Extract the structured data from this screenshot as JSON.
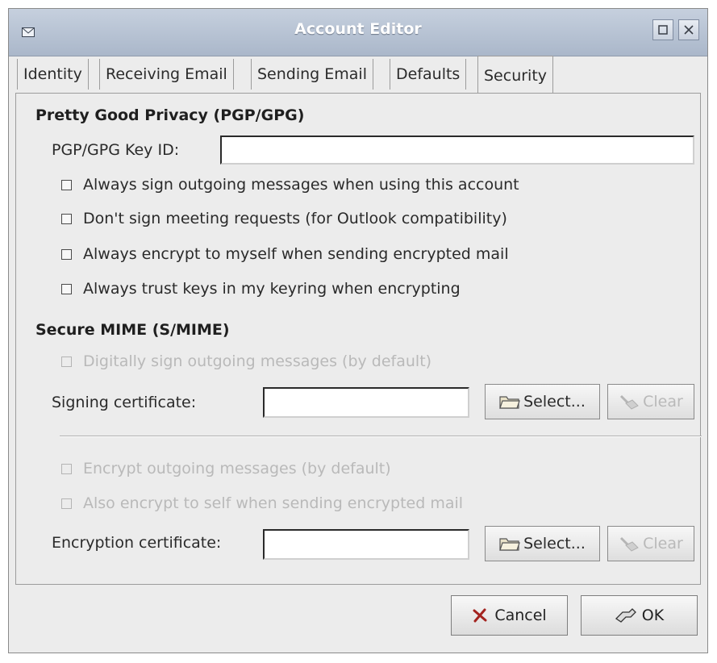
{
  "window": {
    "title": "Account Editor",
    "controls": {
      "maximize_icon": "maximize-icon",
      "close_icon": "close-icon"
    }
  },
  "tabs": [
    {
      "label": "Identity",
      "active": false
    },
    {
      "label": "Receiving Email",
      "active": false
    },
    {
      "label": "Sending Email",
      "active": false
    },
    {
      "label": "Defaults",
      "active": false
    },
    {
      "label": "Security",
      "active": true
    }
  ],
  "pgp": {
    "section_title": "Pretty Good Privacy (PGP/GPG)",
    "key_id_label": "PGP/GPG Key ID:",
    "key_id_value": "",
    "options": [
      {
        "label": "Always sign outgoing messages when using this account",
        "checked": false,
        "enabled": true
      },
      {
        "label": "Don't sign meeting requests (for Outlook compatibility)",
        "checked": false,
        "enabled": true
      },
      {
        "label": "Always encrypt to myself when sending encrypted mail",
        "checked": false,
        "enabled": true
      },
      {
        "label": "Always trust keys in my keyring when encrypting",
        "checked": false,
        "enabled": true
      }
    ]
  },
  "smime": {
    "section_title": "Secure MIME (S/MIME)",
    "sign_default_label": "Digitally sign outgoing messages (by default)",
    "signing_cert_label": "Signing certificate:",
    "signing_cert_value": "",
    "encrypt_default_label": "Encrypt outgoing messages (by default)",
    "encrypt_self_label": "Also encrypt to self when sending encrypted mail",
    "encryption_cert_label": "Encryption certificate:",
    "encryption_cert_value": "",
    "select_label": "Select...",
    "clear_label": "Clear"
  },
  "footer": {
    "cancel_label": "Cancel",
    "ok_label": "OK"
  },
  "colors": {
    "title_bar": "#b4c0d2",
    "window_bg": "#ececec",
    "disabled_text": "#b9b9b9"
  }
}
